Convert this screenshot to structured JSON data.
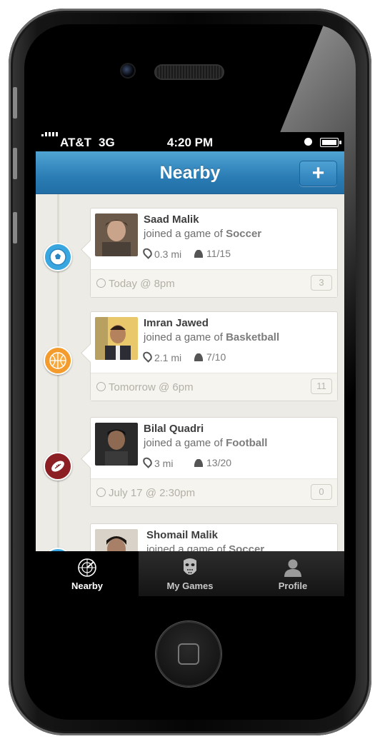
{
  "status_bar": {
    "carrier": "AT&T",
    "network": "3G",
    "time": "4:20 PM"
  },
  "nav": {
    "title": "Nearby",
    "add_label": "+"
  },
  "feed": [
    {
      "name": "Saad Malik",
      "action_prefix": "joined a game of",
      "sport": "Soccer",
      "sport_icon": "soccer-ball-icon",
      "sport_color": "#3aa6df",
      "distance": "0.3 mi",
      "players": "11/15",
      "when": "Today @ 8pm",
      "comments": "3"
    },
    {
      "name": "Imran Jawed",
      "action_prefix": "joined a game of",
      "sport": "Basketball",
      "sport_icon": "basketball-icon",
      "sport_color": "#f39b2c",
      "distance": "2.1 mi",
      "players": "7/10",
      "when": "Tomorrow @ 6pm",
      "comments": "11"
    },
    {
      "name": "Bilal Quadri",
      "action_prefix": "joined a game of",
      "sport": "Football",
      "sport_icon": "football-icon",
      "sport_color": "#8b1f24",
      "distance": "3 mi",
      "players": "13/20",
      "when": "July 17 @ 2:30pm",
      "comments": "0"
    },
    {
      "name": "Shomail Malik",
      "action_prefix": "joined a game of",
      "sport": "Soccer"
    }
  ],
  "tabs": [
    {
      "label": "Nearby",
      "icon": "radar-icon",
      "active": true
    },
    {
      "label": "My Games",
      "icon": "hockey-mask-icon",
      "active": false
    },
    {
      "label": "Profile",
      "icon": "person-icon",
      "active": false
    }
  ]
}
